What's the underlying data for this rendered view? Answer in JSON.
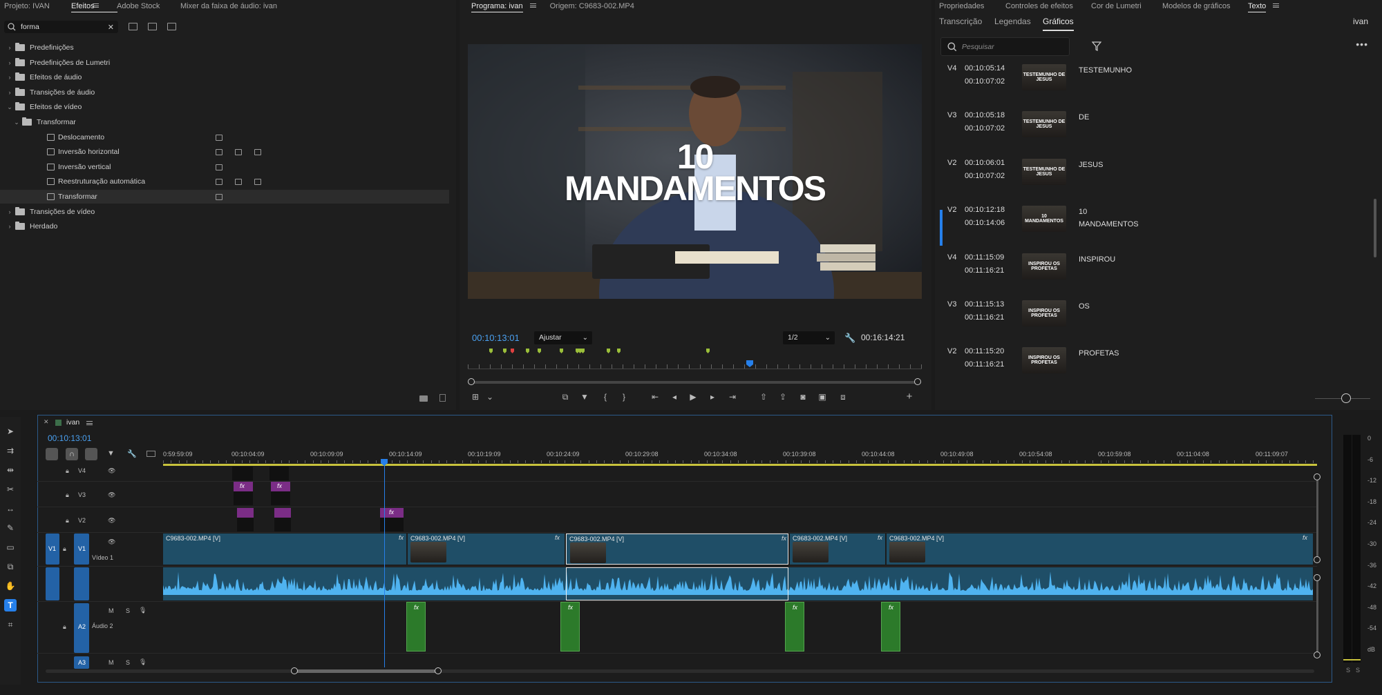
{
  "effects_panel": {
    "tabs": [
      "Projeto: IVAN",
      "Efeitos",
      "Adobe Stock",
      "Mixer da faixa de áudio: ivan"
    ],
    "active_tab": "Efeitos",
    "search_value": "forma",
    "tree": [
      {
        "label": "Predefinições",
        "level": 0,
        "expanded": false,
        "type": "folder"
      },
      {
        "label": "Predefinições de Lumetri",
        "level": 0,
        "expanded": false,
        "type": "folder"
      },
      {
        "label": "Efeitos de áudio",
        "level": 0,
        "expanded": false,
        "type": "folder"
      },
      {
        "label": "Transições de áudio",
        "level": 0,
        "expanded": false,
        "type": "folder"
      },
      {
        "label": "Efeitos de vídeo",
        "level": 0,
        "expanded": true,
        "type": "folder"
      },
      {
        "label": "Transformar",
        "level": 1,
        "expanded": true,
        "type": "folder"
      },
      {
        "label": "Deslocamento",
        "level": 2,
        "type": "effect",
        "badges": 1
      },
      {
        "label": "Inversão horizontal",
        "level": 2,
        "type": "effect",
        "badges": 3
      },
      {
        "label": "Inversão vertical",
        "level": 2,
        "type": "effect",
        "badges": 1
      },
      {
        "label": "Reestruturação automática",
        "level": 2,
        "type": "effect",
        "badges": 3
      },
      {
        "label": "Transformar",
        "level": 2,
        "type": "effect",
        "badges": 1,
        "selected": true
      },
      {
        "label": "Transições de vídeo",
        "level": 0,
        "expanded": false,
        "type": "folder"
      },
      {
        "label": "Herdado",
        "level": 0,
        "expanded": false,
        "type": "folder"
      }
    ]
  },
  "program_monitor": {
    "tabs": [
      "Programa: ivan",
      "Origem: C9683-002.MP4"
    ],
    "overlay_line1": "10",
    "overlay_line2": "MANDAMENTOS",
    "current_time": "00:10:13:01",
    "fit": "Ajustar",
    "resolution": "1/2",
    "duration": "00:16:14:21"
  },
  "graphics_panel": {
    "tabs": [
      "Propriedades",
      "Controles de efeitos",
      "Cor de Lumetri",
      "Modelos de gráficos",
      "Texto"
    ],
    "subtabs": [
      "Transcrição",
      "Legendas",
      "Gráficos"
    ],
    "active_subtab": "Gráficos",
    "workspace_user": "ivan",
    "search_placeholder": "Pesquisar",
    "items": [
      {
        "track": "V4",
        "in": "00:10:05:14",
        "out": "00:10:07:02",
        "text": "TESTEMUNHO",
        "thumb": "TESTEMUNHO DE JESUS"
      },
      {
        "track": "V3",
        "in": "00:10:05:18",
        "out": "00:10:07:02",
        "text": "DE",
        "thumb": "TESTEMUNHO DE JESUS"
      },
      {
        "track": "V2",
        "in": "00:10:06:01",
        "out": "00:10:07:02",
        "text": "JESUS",
        "thumb": "TESTEMUNHO DE JESUS"
      },
      {
        "track": "V2",
        "in": "00:10:12:18",
        "out": "00:10:14:06",
        "text": "10\nMANDAMENTOS",
        "thumb": "10 MANDAMENTOS",
        "active": true
      },
      {
        "track": "V4",
        "in": "00:11:15:09",
        "out": "00:11:16:21",
        "text": "INSPIROU",
        "thumb": "INSPIROU OS PROFETAS"
      },
      {
        "track": "V3",
        "in": "00:11:15:13",
        "out": "00:11:16:21",
        "text": "OS",
        "thumb": "INSPIROU OS PROFETAS"
      },
      {
        "track": "V2",
        "in": "00:11:15:20",
        "out": "00:11:16:21",
        "text": "PROFETAS",
        "thumb": "INSPIROU OS PROFETAS"
      }
    ]
  },
  "timeline": {
    "sequence_name": "ivan",
    "current_time": "00:10:13:01",
    "ruler": [
      "0:59:59:09",
      "00:10:04:09",
      "00:10:09:09",
      "00:10:14:09",
      "00:10:19:09",
      "00:10:24:09",
      "00:10:29:08",
      "00:10:34:08",
      "00:10:39:08",
      "00:10:44:08",
      "00:10:49:08",
      "00:10:54:08",
      "00:10:59:08",
      "00:11:04:08",
      "00:11:09:07"
    ],
    "tracks": {
      "v4": "V4",
      "v3": "V3",
      "v2": "V2",
      "v1": "V1",
      "v1_name": "Vídeo 1",
      "a2": "A2",
      "a2_name": "Áudio 2",
      "a3": "A3",
      "m": "M",
      "s": "S"
    },
    "clip_name": "C9683-002.MP4 [V]",
    "fx": "fx",
    "meter_scale": [
      "0",
      "-6",
      "-12",
      "-18",
      "-24",
      "-30",
      "-36",
      "-42",
      "-48",
      "-54",
      "dB"
    ],
    "meter_solo": [
      "S",
      "S"
    ]
  },
  "colors": {
    "accent": "#2680eb",
    "clip_video": "#1f4e67",
    "audio_wave": "#4fb3f0",
    "fx_green": "#2c7a2a",
    "title_purple": "#7b2d86"
  }
}
